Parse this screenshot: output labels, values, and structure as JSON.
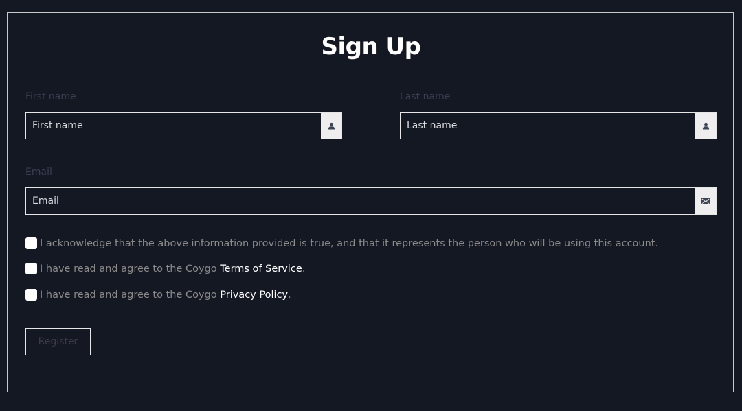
{
  "form": {
    "title": "Sign Up",
    "first_name": {
      "label": "First name",
      "placeholder": "First name",
      "value": "",
      "icon": "user-icon"
    },
    "last_name": {
      "label": "Last name",
      "placeholder": "Last name",
      "value": "",
      "icon": "user-icon"
    },
    "email": {
      "label": "Email",
      "placeholder": "Email",
      "value": "",
      "icon": "envelope-icon"
    },
    "checkboxes": [
      {
        "text": "I acknowledge that the above information provided is true, and that it represents the person who will be using this account.",
        "link": "",
        "suffix": "",
        "checked": false
      },
      {
        "text": "I have read and agree to the Coygo ",
        "link": "Terms of Service",
        "suffix": ".",
        "checked": false
      },
      {
        "text": "I have read and agree to the Coygo ",
        "link": "Privacy Policy",
        "suffix": ".",
        "checked": false
      }
    ],
    "register_label": "Register"
  },
  "colors": {
    "background": "#141822",
    "border": "#e6e6e6",
    "label": "#3a3f52",
    "link": "#ffffff",
    "muted_text": "#8a8a8a"
  }
}
